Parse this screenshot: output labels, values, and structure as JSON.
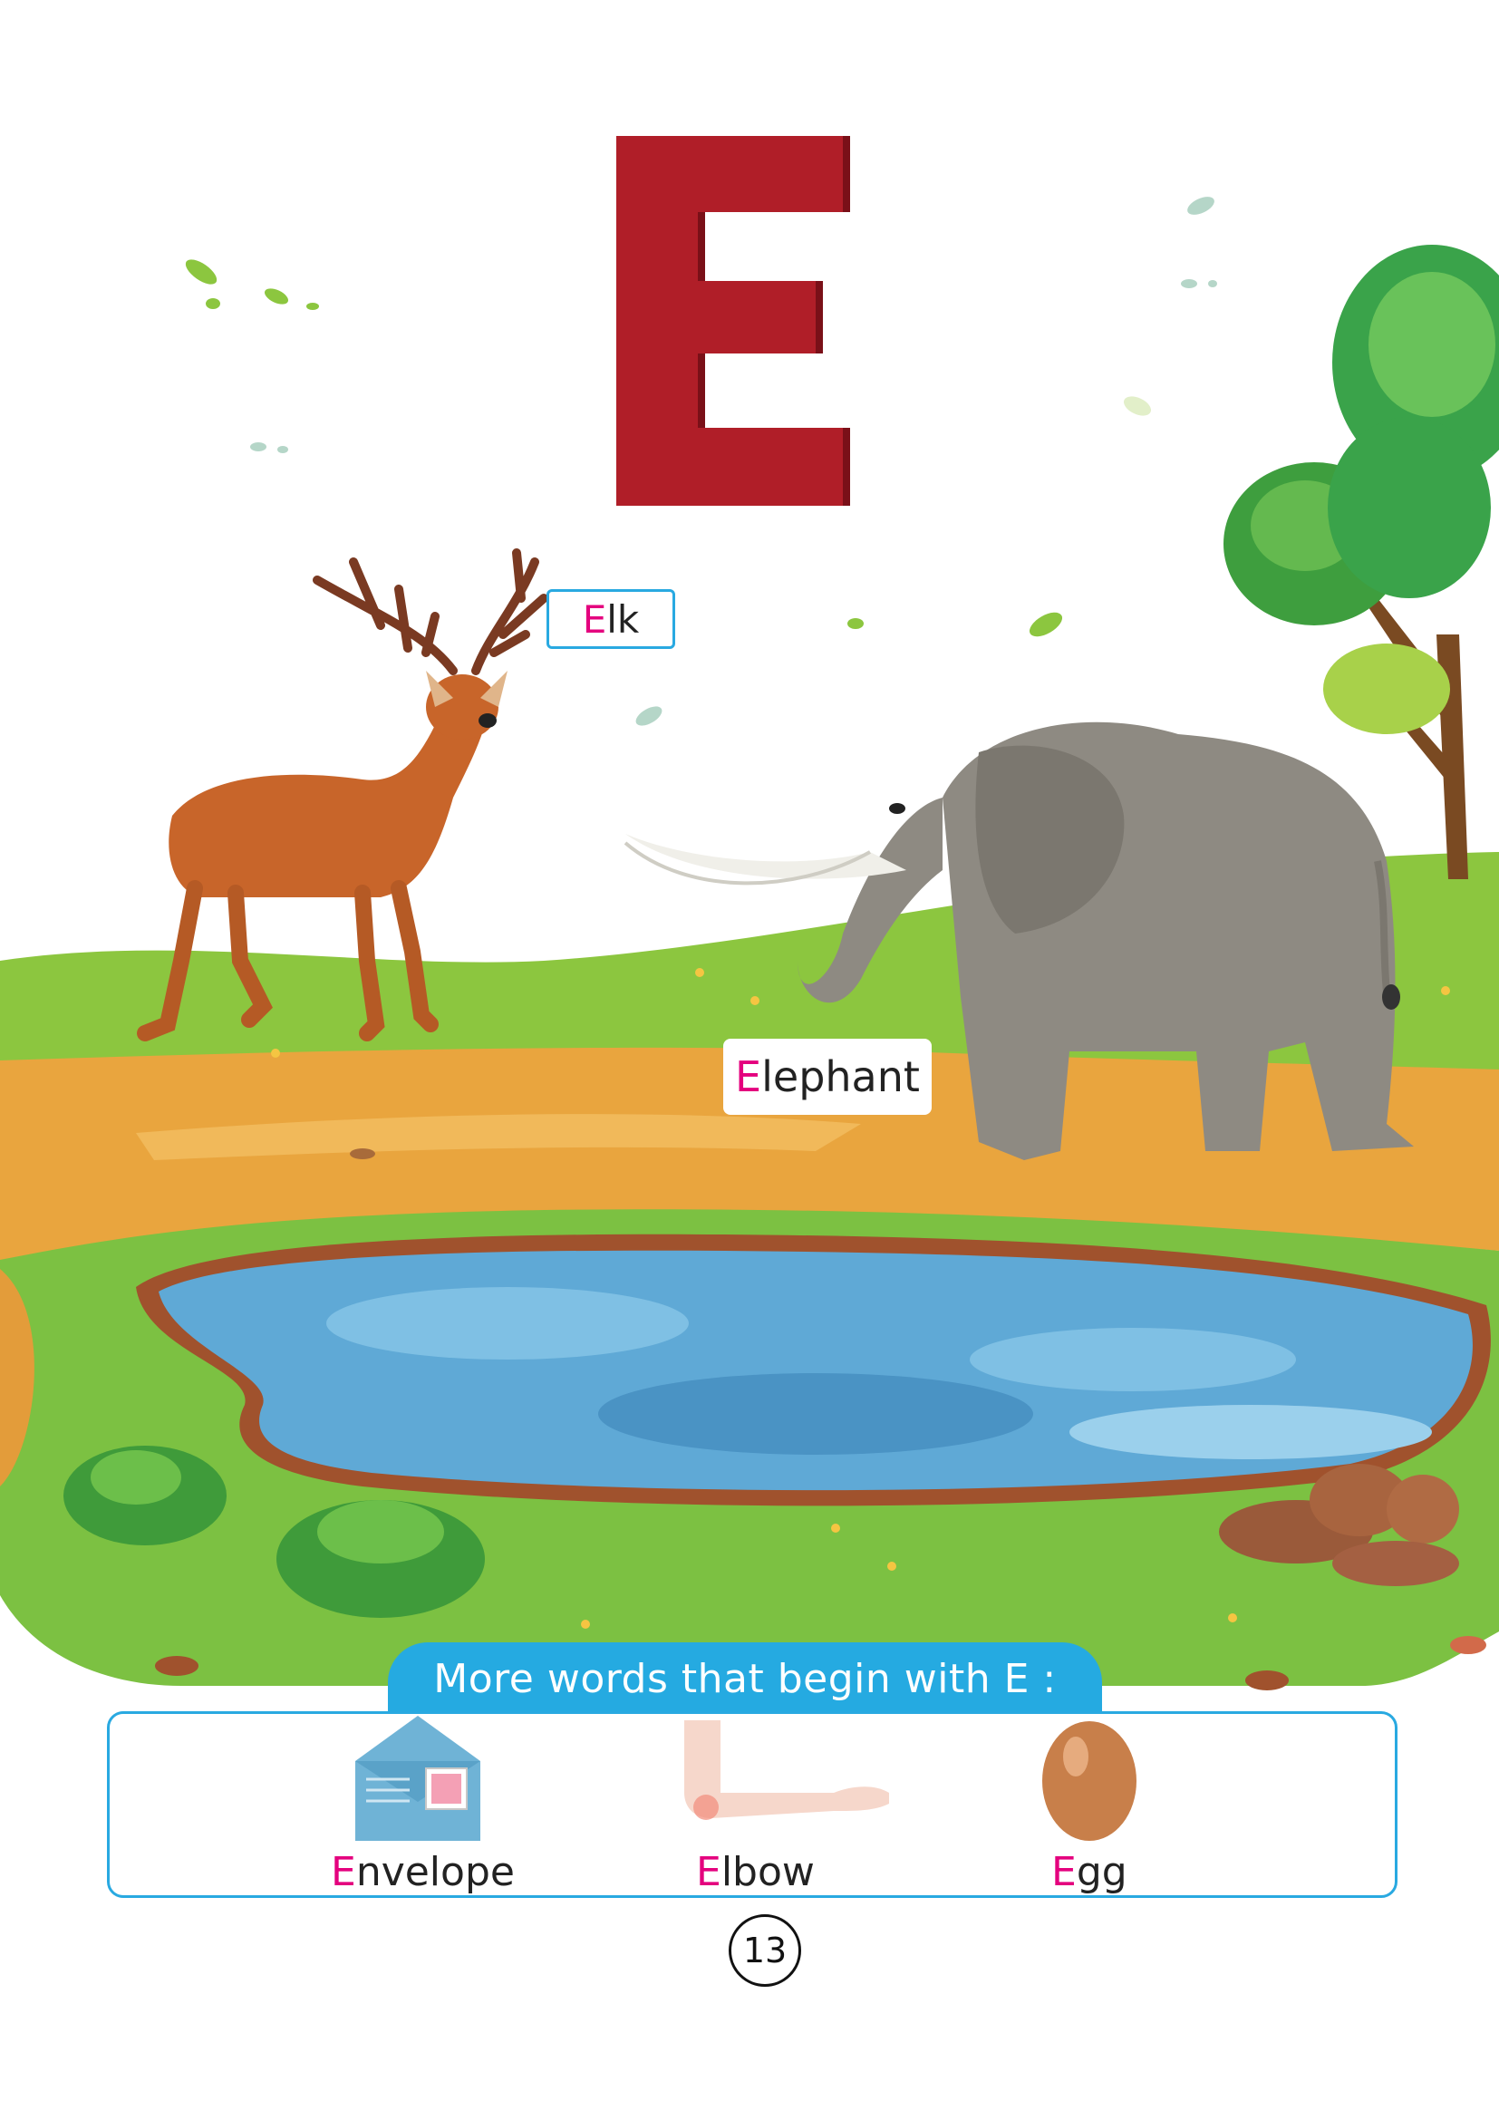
{
  "letter": "E",
  "colors": {
    "letter": "#b01e28",
    "letter_shadow": "#7a1018",
    "highlight_first_letter": "#e4007e",
    "accent_blue": "#25aae1",
    "grass": "#7cc142",
    "dirt": "#e8a23c",
    "water": "#5fa9d6"
  },
  "scene_labels": [
    {
      "first": "E",
      "rest": "lk"
    },
    {
      "first": "E",
      "rest": "lephant"
    }
  ],
  "more_words": {
    "heading": "More words that begin with E :",
    "items": [
      {
        "first": "E",
        "rest": "nvelope",
        "icon": "envelope-icon"
      },
      {
        "first": "E",
        "rest": "lbow",
        "icon": "elbow-icon"
      },
      {
        "first": "E",
        "rest": "gg",
        "icon": "egg-icon"
      }
    ]
  },
  "page_number": "13"
}
